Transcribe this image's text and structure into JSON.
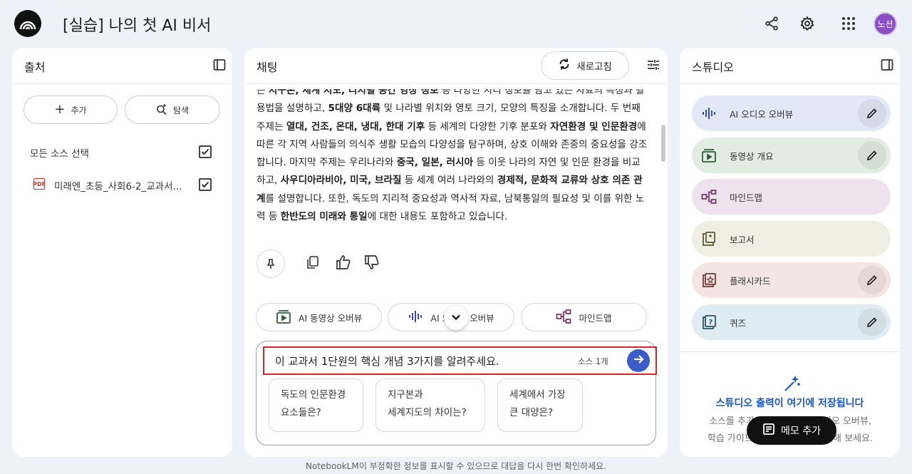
{
  "app": {
    "title": "[실습] 나의 첫 AI 비서",
    "avatar_text": "노션"
  },
  "sources": {
    "title": "출처",
    "add_label": "추가",
    "explore_label": "탐색",
    "select_all_label": "모든 소스 선택",
    "items": [
      {
        "icon": "pdf-icon",
        "name": "미래엔_초등_사회6-2_교과서...",
        "checked": true
      }
    ]
  },
  "chat": {
    "title": "채팅",
    "refresh_label": "새로고침",
    "message_segments": [
      {
        "t": "은 ",
        "b": false
      },
      {
        "t": "지구본, 세계 지도, 디지털 공간 영상 정보",
        "b": true
      },
      {
        "t": " 등 다양한 지리 정보를 담고 있는 자료의 특징과 활용법을 설명하고, ",
        "b": false
      },
      {
        "t": "5대양 6대륙",
        "b": true
      },
      {
        "t": " 및 나라별 위치와 영토 크기, 모양의 특징을 소개합니다. 두 번째 주제는 ",
        "b": false
      },
      {
        "t": "열대, 건조, 온대, 냉대, 한대 기후",
        "b": true
      },
      {
        "t": " 등 세계의 다양한 기후 분포와 ",
        "b": false
      },
      {
        "t": "자연환경 및 인문환경",
        "b": true
      },
      {
        "t": "에 따른 각 지역 사람들의 의식주 생활 모습의 다양성을 탐구하며, 상호 이해와 존중의 중요성을 강조합니다. 마지막 주제는 우리나라와 ",
        "b": false
      },
      {
        "t": "중국, 일본, 러시아",
        "b": true
      },
      {
        "t": " 등 이웃 나라의 자연 및 인문 환경을 비교하고, ",
        "b": false
      },
      {
        "t": "사우디아라비아, 미국, 브라질",
        "b": true
      },
      {
        "t": " 등 세계 여러 나라와의 ",
        "b": false
      },
      {
        "t": "경제적, 문화적 교류와 상호 의존 관계",
        "b": true
      },
      {
        "t": "를 설명합니다. 또한, 독도의 지리적 중요성과 역사적 자료, 남북통일의 필요성 및 이를 위한 노력 등 ",
        "b": false
      },
      {
        "t": "한반도의 미래와 통일",
        "b": true
      },
      {
        "t": "에 대한 내용도 포함하고 있습니다.",
        "b": false
      }
    ],
    "quick_actions": [
      "AI 동영상 오버뷰",
      "AI 오디오 오버뷰",
      "마인드맵"
    ],
    "input_value": "이 교과서 1단원의 핵심 개념 3가지를 알려주세요.",
    "source_count": "소스 1개",
    "suggestions": [
      {
        "line1": "독도의 인문환경",
        "line2": "요소들은?"
      },
      {
        "line1": "지구본과",
        "line2": "세계지도의 차이는?"
      },
      {
        "line1": "세계에서 가장",
        "line2": "큰 대양은?"
      }
    ],
    "disclaimer": "NotebookLM이 부정확한 정보를 표시할 수 있으므로 대답을 다시 한번 확인하세요."
  },
  "studio": {
    "title": "스튜디오",
    "items": [
      {
        "label": "AI 오디오 오버뷰",
        "color": "#e3e8f6",
        "icon_color": "#3b4ba8",
        "editable": true
      },
      {
        "label": "동영상 개요",
        "color": "#e2ece3",
        "icon_color": "#2e5d36",
        "editable": true
      },
      {
        "label": "마인드맵",
        "color": "#eee3ec",
        "icon_color": "#7a3a6d",
        "editable": false
      },
      {
        "label": "보고서",
        "color": "#efeee2",
        "icon_color": "#5c5a30",
        "editable": false
      },
      {
        "label": "플래시카드",
        "color": "#f3e5e4",
        "icon_color": "#7a3535",
        "editable": true
      },
      {
        "label": "퀴즈",
        "color": "#e0ecf3",
        "icon_color": "#2b5570",
        "editable": true
      }
    ],
    "empty_title": "스튜디오 출력이 여기에 저장됩니다",
    "empty_desc_line1": "소스를 추가한 후 클릭하여 오디오 오버뷰,",
    "empty_desc_line2": "학습 가이드, 마인드맵 등을 추가해 보세요.",
    "memo_label": "메모 추가"
  }
}
